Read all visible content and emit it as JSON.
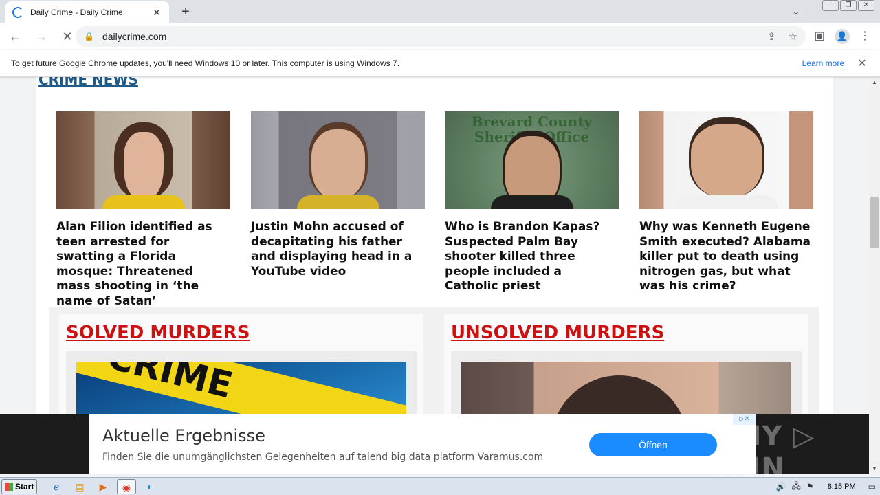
{
  "browser": {
    "tab_title": "Daily Crime - Daily Crime",
    "url": "dailycrime.com",
    "new_tab_symbol": "+",
    "tab_close_symbol": "✕"
  },
  "infobar": {
    "message": "To get future Google Chrome updates, you'll need Windows 10 or later. This computer is using Windows 7.",
    "learn_more": "Learn more"
  },
  "page": {
    "section_title": "CRIME NEWS",
    "cards": [
      {
        "headline": "Alan Filion identified as teen arrested for swatting a Florida mosque: Threatened mass shooting in ‘the name of Satan’"
      },
      {
        "headline": "Justin Mohn accused of decapitating his father and displaying head in a YouTube video"
      },
      {
        "headline": "Who is Brandon Kapas? Suspected Palm Bay shooter killed three people included a Catholic priest",
        "image_caption": "Brevard County Sheriff's Office"
      },
      {
        "headline": "Why was Kenneth Eugene Smith executed? Alabama killer put to death using nitrogen gas, but what was his crime?"
      }
    ],
    "panels": [
      {
        "title": "SOLVED MURDERS",
        "image_text": "CRIME"
      },
      {
        "title": "UNSOLVED MURDERS"
      }
    ]
  },
  "ad": {
    "title": "Aktuelle Ergebnisse",
    "text": "Finden Sie die unumgänglichsten Gelegenheiten auf talend big data platform Varamus.com",
    "button": "Öffnen",
    "adchoices": "▷✕",
    "watermark": "ANY ▷ RUN"
  },
  "taskbar": {
    "start": "Start",
    "clock": "8:15 PM"
  }
}
